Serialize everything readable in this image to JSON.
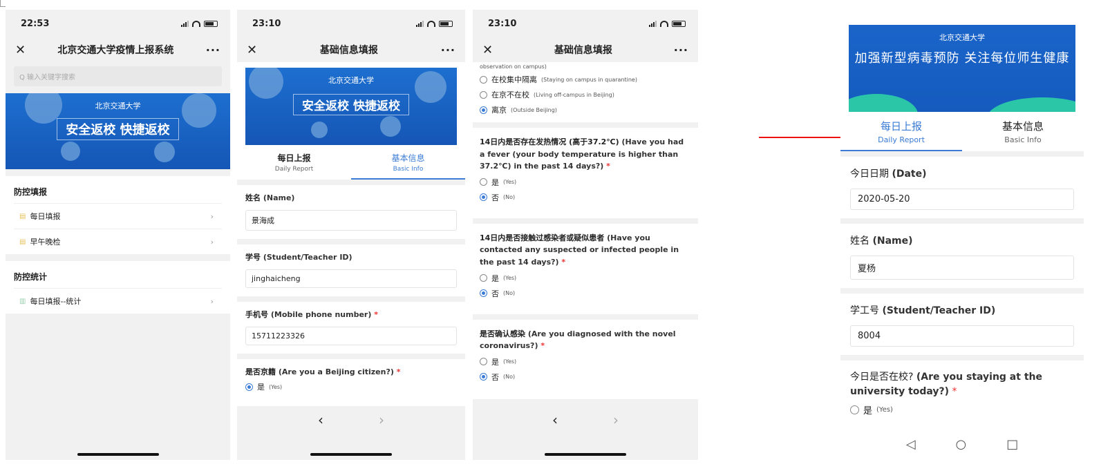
{
  "p1": {
    "time": "22:53",
    "nav_title": "北京交通大学疫情上报系统",
    "close": "✕",
    "more": "···",
    "search_placeholder": "Q 输入关键字搜索",
    "banner_logo": "北京交通大学",
    "banner_text": "安全返校 快捷返校",
    "card1_title": "防控填报",
    "card1_items": [
      "每日填报",
      "早午晚检"
    ],
    "card2_title": "防控统计",
    "card2_items": [
      "每日填报--统计"
    ]
  },
  "p2": {
    "time": "23:10",
    "nav_title": "基础信息填报",
    "close": "✕",
    "more": "···",
    "banner_logo": "北京交通大学",
    "banner_text": "安全返校 快捷返校",
    "tabs": [
      {
        "cn": "每日上报",
        "en": "Daily Report"
      },
      {
        "cn": "基本信息",
        "en": "Basic Info"
      }
    ],
    "name_label": "姓名",
    "name_en": "(Name)",
    "name_value": "景海成",
    "id_label": "学号",
    "id_en": "(Student/Teacher ID)",
    "id_value": "jinghaicheng",
    "phone_label": "手机号",
    "phone_en": "(Mobile phone number)",
    "phone_value": "15711223326",
    "bj_label": "是否京籍",
    "bj_en": "(Are you a Beijing citizen?)",
    "yes": "是",
    "yes_en": "(Yes)",
    "back": "‹",
    "forward": "›",
    "req": "*"
  },
  "p3": {
    "time": "23:10",
    "nav_title": "基础信息填报",
    "close": "✕",
    "more": "···",
    "top_partial": "observation on campus)",
    "loc_options": [
      {
        "cn": "在校集中隔离",
        "en": "(Staying on campus in quarantine)"
      },
      {
        "cn": "在京不在校",
        "en": "(Living off-campus in Beijing)"
      },
      {
        "cn": "离京",
        "en": "(Outside Beijing)"
      }
    ],
    "q1": "14日内是否存在发热情况 (高于37.2℃)",
    "q1_en": "(Have you had a fever (your body temperature is higher than 37.2℃) in the past 14 days?)",
    "q2": "14日内是否接触过感染者或疑似患者",
    "q2_en": "(Have you contacted any suspected or infected people in the past 14 days?)",
    "q3": "是否确认感染",
    "q3_en": "(Are you diagnosed with the novel coronavirus?)",
    "yes": "是",
    "yes_en": "(Yes)",
    "no": "否",
    "no_en": "(No)",
    "back": "‹",
    "forward": "›",
    "req": "*"
  },
  "p4": {
    "banner_logo": "北京交通大学",
    "banner_text": "加强新型病毒预防 关注每位师生健康",
    "tabs": [
      {
        "cn": "每日上报",
        "en": "Daily Report"
      },
      {
        "cn": "基本信息",
        "en": "Basic Info"
      }
    ],
    "date_label": "今日日期",
    "date_en": "(Date)",
    "date_value": "2020-05-20",
    "name_label": "姓名",
    "name_en": "(Name)",
    "name_value": "夏杨",
    "id_label": "学工号",
    "id_en": "(Student/Teacher ID)",
    "id_value": "8004",
    "school_label": "今日是否在校?",
    "school_en": "(Are you staying at the university today?)",
    "yes": "是",
    "yes_en": "(Yes)",
    "req": "*",
    "nav_back": "◁",
    "nav_home": "○",
    "nav_recent": "□"
  },
  "colors": {
    "accent": "#3a7bd5",
    "arrow": "#e11111",
    "required": "#e33333"
  }
}
